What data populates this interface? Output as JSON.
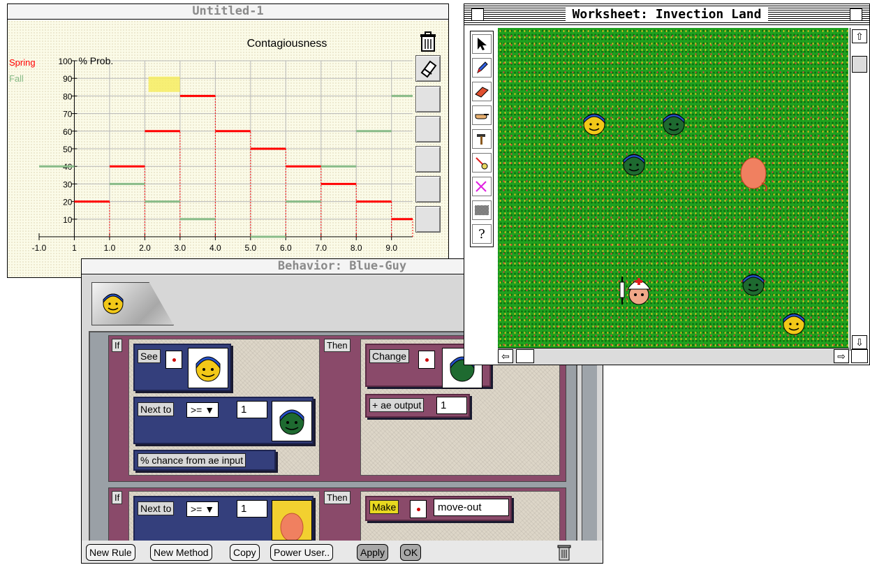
{
  "chart_window": {
    "title": "Untitled-1",
    "chart_data": {
      "type": "line",
      "title": "Contagiousness",
      "ylabel": "% Prob.",
      "xlim": [
        -1.0,
        9.6
      ],
      "ylim": [
        0,
        100
      ],
      "x_tick_labels": [
        "-1.0",
        "1",
        "1.0",
        "2.0",
        "3.0",
        "4.0",
        "5.0",
        "6.0",
        "7.0",
        "8.0",
        "9.0"
      ],
      "x_ticks": [
        -1.0,
        0,
        1.0,
        2.0,
        3.0,
        4.0,
        5.0,
        6.0,
        7.0,
        8.0,
        9.0
      ],
      "y_tick_labels": [
        "10",
        "20",
        "30",
        "40",
        "50",
        "60",
        "70",
        "80",
        "90",
        "100"
      ],
      "y_ticks": [
        10,
        20,
        30,
        40,
        50,
        60,
        70,
        80,
        90,
        100
      ],
      "grid": true,
      "legend_position": "top-left",
      "series": [
        {
          "name": "Spring",
          "color": "#ff0000",
          "steps": [
            {
              "x0": 0,
              "x1": 1,
              "y": 20
            },
            {
              "x0": 1,
              "x1": 2,
              "y": 40
            },
            {
              "x0": 2,
              "x1": 3,
              "y": 60
            },
            {
              "x0": 3,
              "x1": 4,
              "y": 80
            },
            {
              "x0": 4,
              "x1": 5,
              "y": 60
            },
            {
              "x0": 5,
              "x1": 6,
              "y": 50
            },
            {
              "x0": 6,
              "x1": 7,
              "y": 40
            },
            {
              "x0": 7,
              "x1": 8,
              "y": 30
            },
            {
              "x0": 8,
              "x1": 9,
              "y": 20
            },
            {
              "x0": 9,
              "x1": 9.6,
              "y": 10
            }
          ]
        },
        {
          "name": "Fall",
          "color": "#88bb88",
          "steps": [
            {
              "x0": -1,
              "x1": 0,
              "y": 40
            },
            {
              "x0": 1,
              "x1": 2,
              "y": 30
            },
            {
              "x0": 2,
              "x1": 3,
              "y": 20
            },
            {
              "x0": 3,
              "x1": 4,
              "y": 10
            },
            {
              "x0": 5,
              "x1": 6,
              "y": 0
            },
            {
              "x0": 6,
              "x1": 7,
              "y": 20
            },
            {
              "x0": 7,
              "x1": 8,
              "y": 40
            },
            {
              "x0": 8,
              "x1": 9,
              "y": 60
            },
            {
              "x0": 9,
              "x1": 9.6,
              "y": 80
            }
          ]
        }
      ],
      "highlight_x": 2.6
    },
    "trash_icon": "trash-icon",
    "side_tool_icon": "eraser-tool-icon"
  },
  "behavior_window": {
    "title": "Behavior: Blue-Guy",
    "rule1": {
      "if_label": "If",
      "then_label": "Then",
      "see_label": "See",
      "next_to_label": "Next to",
      "next_to_op": ">=",
      "next_to_value": "1",
      "chance_label": "% chance from ae input",
      "change_label": "Change",
      "output_label": "+ ae output",
      "output_value": "1"
    },
    "rule2": {
      "if_label": "If",
      "then_label": "Then",
      "next_to_label": "Next to",
      "next_to_op": ">=",
      "next_to_value": "1",
      "make_label": "Make",
      "make_value": "move-out"
    },
    "buttons": {
      "new_rule": "New Rule",
      "new_method": "New Method",
      "copy": "Copy",
      "power_user": "Power User..",
      "apply": "Apply",
      "ok": "OK"
    }
  },
  "worksheet_window": {
    "title": "Worksheet: Invection Land",
    "tools": [
      "arrow-tool-icon",
      "pencil-tool-icon",
      "eraser-tool-icon",
      "hand-tool-icon",
      "hammer-tool-icon",
      "duplicate-tool-icon",
      "delete-tool-icon",
      "pattern-tool-icon",
      "help-tool-icon"
    ],
    "help_glyph": "?",
    "colors": {
      "grass": "#1fa11f",
      "healthy": "#f2c818",
      "infected": "#1e6a30",
      "cap": "#2450c8",
      "blob": "#f08060"
    }
  }
}
